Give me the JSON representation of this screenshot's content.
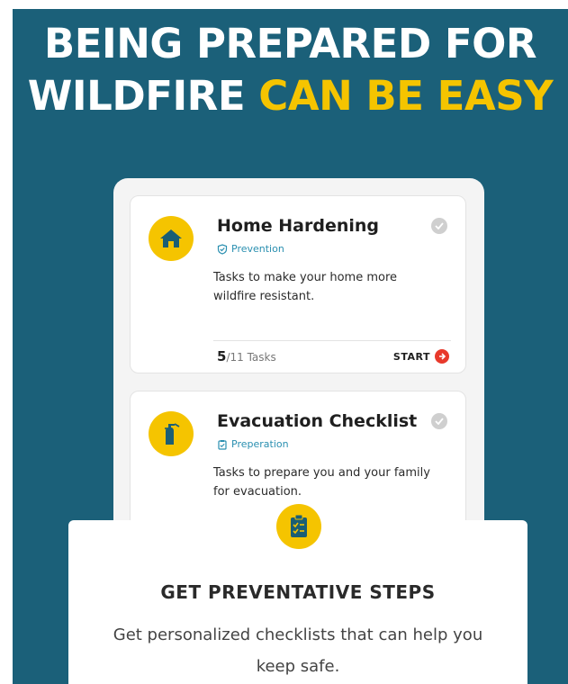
{
  "headline": {
    "line1": "BEING PREPARED FOR",
    "line2_white": "WILDFIRE ",
    "line2_accent": "CAN BE EASY"
  },
  "cards": [
    {
      "title": "Home Hardening",
      "tag": "Prevention",
      "description": "Tasks to make your home more wildfire resistant.",
      "completed": "5",
      "total": "/11 Tasks",
      "action": "START",
      "icon": "house-icon"
    },
    {
      "title": "Evacuation Checklist",
      "tag": "Preperation",
      "description": "Tasks to prepare you and your family for evacuation.",
      "icon": "fire-extinguisher-icon"
    }
  ],
  "feature": {
    "icon": "clipboard-check-icon",
    "title": "GET PREVENTATIVE STEPS",
    "description": "Get personalized checklists that can help you keep safe."
  },
  "colors": {
    "background": "#1b6079",
    "accent": "#f5c400",
    "start": "#e8392b",
    "tag": "#2a8fb0"
  }
}
